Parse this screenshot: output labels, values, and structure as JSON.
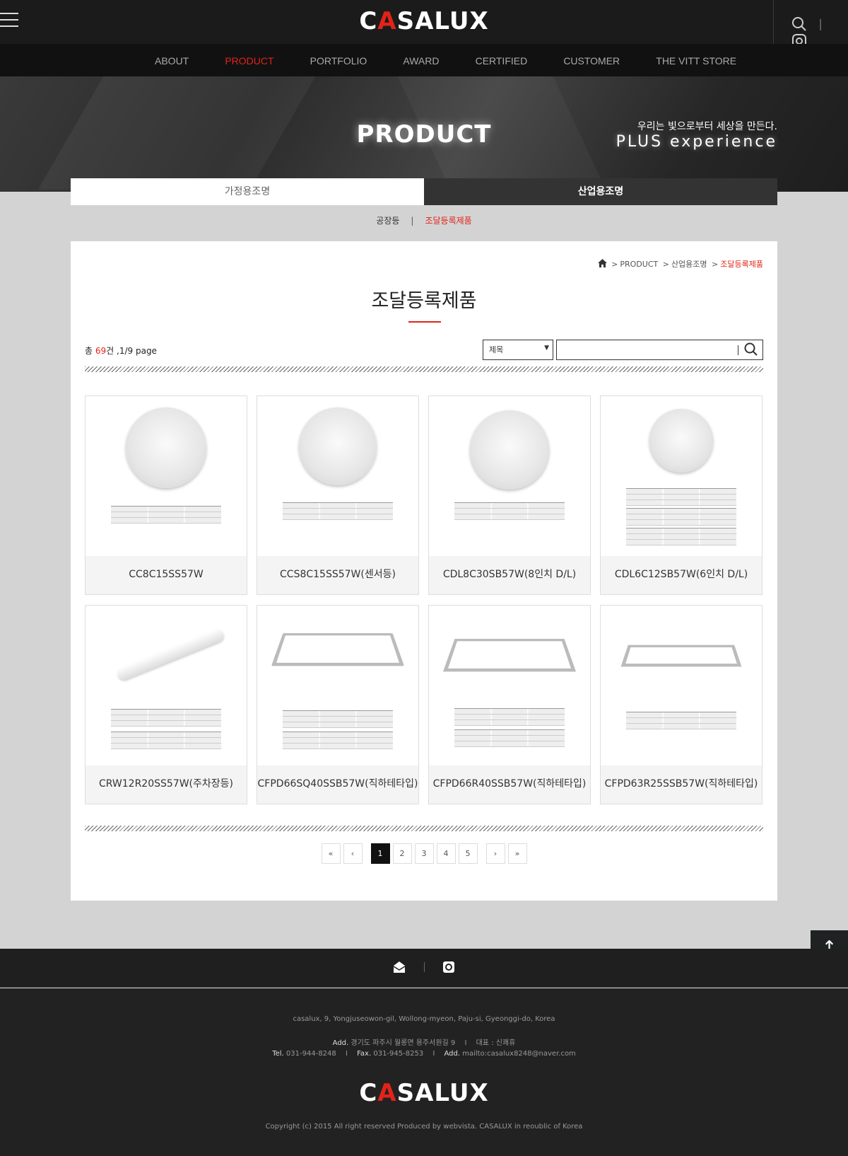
{
  "header": {
    "logo": {
      "pre": "C",
      "accent": "A",
      "post": "SALUX"
    },
    "nav": [
      "ABOUT",
      "PRODUCT",
      "PORTFOLIO",
      "AWARD",
      "CERTIFIED",
      "CUSTOMER",
      "THE VITT STORE"
    ],
    "active_nav": "PRODUCT",
    "separator": "|"
  },
  "hero": {
    "title": "PRODUCT",
    "tagline_kr": "우리는 빛으로부터 세상을 만든다.",
    "tagline_en": "PLUS experience"
  },
  "tabs": [
    "가정용조명",
    "산업용조명"
  ],
  "subtabs": {
    "items": [
      "공장등",
      "조달등록제품"
    ],
    "sep": "|",
    "active_marker": "˅"
  },
  "breadcrumb": {
    "sep": ">",
    "level1": "PRODUCT",
    "level2": "산업용조명",
    "current": "조달등록제품"
  },
  "page_title": "조달등록제품",
  "listing": {
    "count_prefix": "총",
    "count": "69",
    "count_suffix": "건",
    "page_info": ",1/9 page",
    "search_select": "제목",
    "search_value": ""
  },
  "products": [
    "CC8C15SS57W",
    "CCS8C15SS57W(센서등)",
    "CDL8C30SB57W(8인치 D/L)",
    "CDL6C12SB57W(6인치 D/L)",
    "CRW12R20SS57W(주차장등)",
    "CFPD66SQ40SSB57W(직하테타입)",
    "CFPD66R40SSB57W(직하테타입)",
    "CFPD63R25SSB57W(직하테타입)"
  ],
  "pagination": {
    "first": "«",
    "prev": "‹",
    "pages": [
      "1",
      "2",
      "3",
      "4",
      "5"
    ],
    "current": "1",
    "next": "›",
    "last": "»"
  },
  "to_top": "↑",
  "footer": {
    "address_en": "casalux, 9, Yongjuseowon-gil, Wollong-myeon, Paju-si, Gyeonggi-do, Korea",
    "add_label": "Add.",
    "address_kr": "경기도 파주시 월롱면 용주서원길 9",
    "ceo_label": "대표 : 신쾌휴",
    "tel_label": "Tel.",
    "tel": "031-944-8248",
    "fax_label": "Fax.",
    "fax": "031-945-8253",
    "mail_label": "Add.",
    "mail": "mailto:casalux8248@naver.com",
    "sep": "I",
    "copyright": "Copyright (c) 2015 All right reserved Produced by webvista. CASALUX in reoublic of Korea"
  },
  "colors": {
    "accent": "#e2231a",
    "dark": "#1b1b1b",
    "bg": "#d3d3d3"
  },
  "icons": [
    "menu-icon",
    "search-icon",
    "instagram-icon",
    "home-icon",
    "mail-icon",
    "arrow-up-icon"
  ]
}
